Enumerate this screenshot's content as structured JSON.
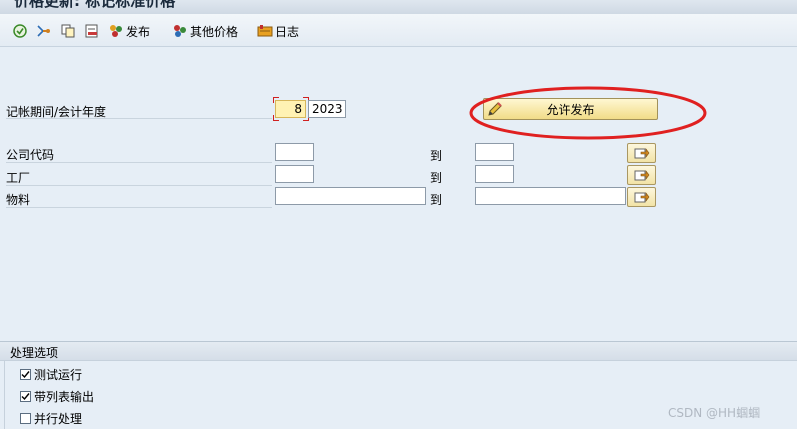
{
  "window": {
    "title": "价格更新: 标记标准价格"
  },
  "toolbar": {
    "items": [
      {
        "icon": "execute-icon",
        "label": ""
      },
      {
        "icon": "variant-icon",
        "label": ""
      },
      {
        "icon": "copy-icon",
        "label": ""
      },
      {
        "icon": "delete-list-icon",
        "label": ""
      },
      {
        "icon": "release-icon",
        "label": "发布"
      },
      {
        "icon": "other-prices-icon",
        "label": "其他价格"
      },
      {
        "icon": "log-icon",
        "label": "日志"
      }
    ]
  },
  "form": {
    "period_label": "记帐期间/会计年度",
    "period_value": "8",
    "year_value": "2023",
    "allow_release_label": "允许发布",
    "company_code_label": "公司代码",
    "plant_label": "工厂",
    "material_label": "物料",
    "to_label": "到",
    "company_code_from": "",
    "company_code_to": "",
    "plant_from": "",
    "plant_to": "",
    "material_from": "",
    "material_to": ""
  },
  "options": {
    "title": "处理选项",
    "items": [
      {
        "label": "测试运行",
        "checked": true
      },
      {
        "label": "带列表输出",
        "checked": true
      },
      {
        "label": "并行处理",
        "checked": false
      }
    ]
  },
  "watermark": "CSDN @HH蝈蝈",
  "colors": {
    "highlight_ellipse": "#e02020",
    "required_field": "#fff2b3",
    "button_gold": "#f1dc88"
  }
}
